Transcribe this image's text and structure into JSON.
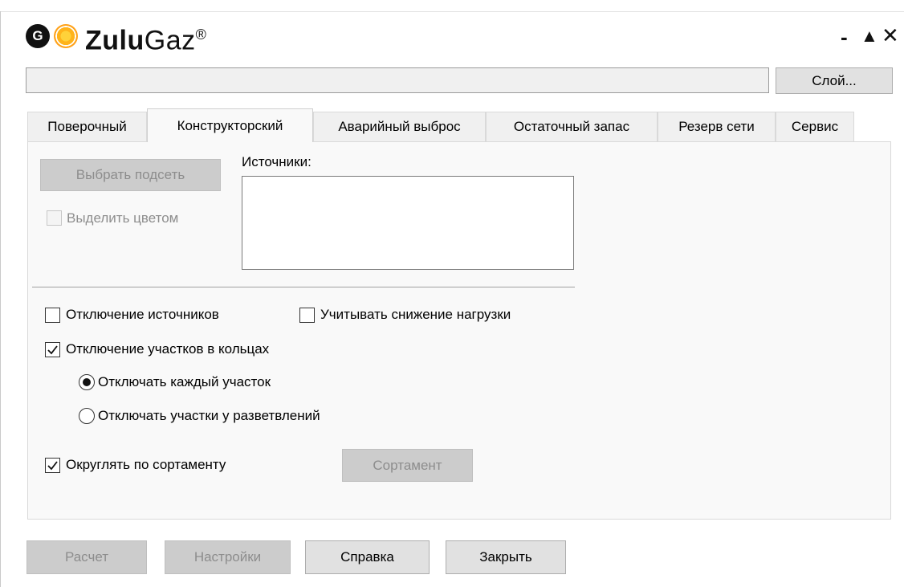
{
  "window": {
    "logo_letter": "G",
    "app_name_bold": "Zulu",
    "app_name_regular": "Gaz",
    "app_name_mark": "®",
    "controls": {
      "minimize": "-",
      "maximize": "▲",
      "close": "✕"
    }
  },
  "path": {
    "value": "",
    "layer_button": "Слой..."
  },
  "tabs": [
    {
      "label": "Поверочный",
      "active": false
    },
    {
      "label": "Конструкторский",
      "active": true
    },
    {
      "label": "Аварийный выброс",
      "active": false
    },
    {
      "label": "Остаточный запас",
      "active": false
    },
    {
      "label": "Резерв сети",
      "active": false
    },
    {
      "label": "Сервис",
      "active": false
    }
  ],
  "panel": {
    "select_subnet_button": "Выбрать подсеть",
    "highlight_color": {
      "label": "Выделить цветом",
      "checked": false,
      "enabled": false
    },
    "sources_label": "Источники:",
    "disable_sources": {
      "label": "Отключение источников",
      "checked": false
    },
    "consider_load_reduction": {
      "label": "Учитывать снижение нагрузки",
      "checked": false
    },
    "disable_ring_sections": {
      "label": "Отключение участков в кольцах",
      "checked": true
    },
    "radio_each_section": {
      "label": "Отключать каждый участок",
      "selected": true
    },
    "radio_branch_sections": {
      "label": "Отключать участки у разветвлений",
      "selected": false
    },
    "round_by_assortment": {
      "label": "Округлять по сортаменту",
      "checked": true
    },
    "assortment_button": "Сортамент"
  },
  "footer": {
    "calculate": "Расчет",
    "settings": "Настройки",
    "help": "Справка",
    "close": "Закрыть"
  }
}
